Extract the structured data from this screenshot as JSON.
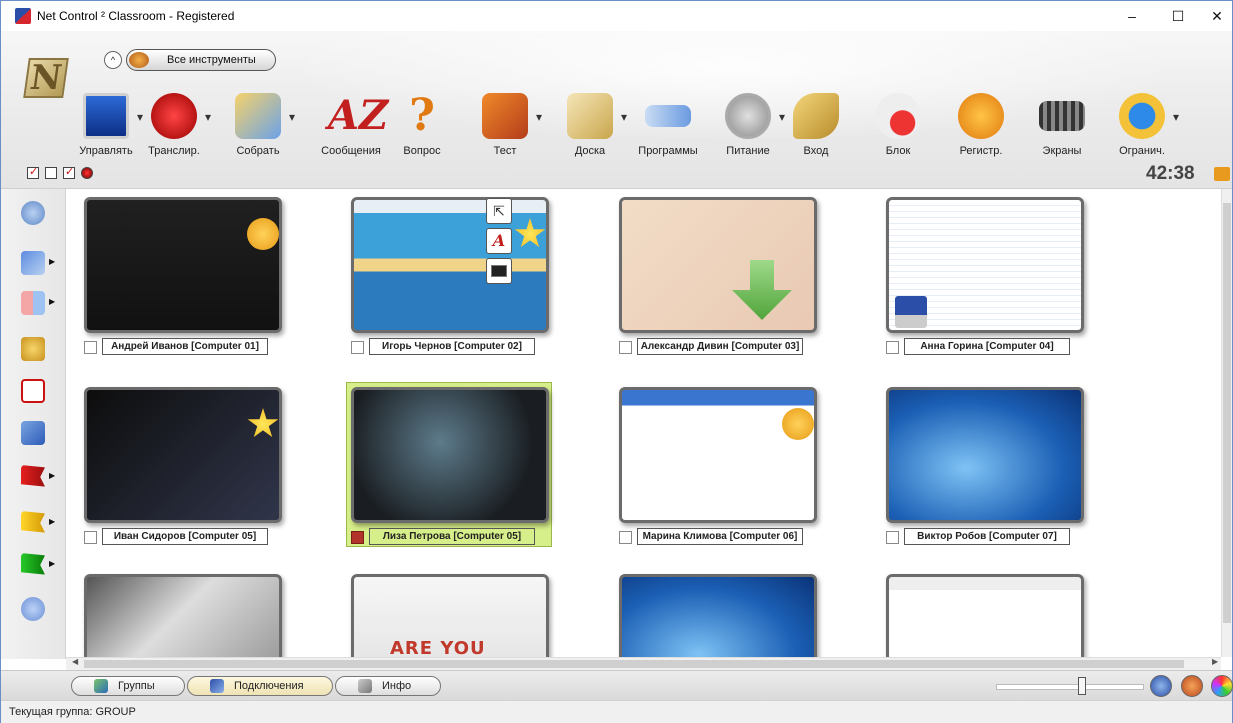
{
  "window": {
    "title": "Net Control ² Classroom - Registered",
    "controls": {
      "minimize": "–",
      "maximize": "☐",
      "close": "✕"
    }
  },
  "ribbon": {
    "logo_letter": "N",
    "collapse_glyph": "^",
    "all_tools_label": "Все инструменты",
    "tools": [
      {
        "id": "manage",
        "label": "Управлять",
        "icon": "monitor-icon",
        "has_dropdown": true
      },
      {
        "id": "broadcast",
        "label": "Транслир.",
        "icon": "broadcast-icon",
        "has_dropdown": true
      },
      {
        "id": "collect",
        "label": "Собрать",
        "icon": "collect-files-icon",
        "has_dropdown": true
      },
      {
        "id": "messages",
        "label": "Сообщения",
        "icon": "az-messages-icon",
        "has_dropdown": false
      },
      {
        "id": "question",
        "label": "Вопрос",
        "icon": "question-icon",
        "has_dropdown": false
      },
      {
        "id": "test",
        "label": "Тест",
        "icon": "test-icon",
        "has_dropdown": true
      },
      {
        "id": "board",
        "label": "Доска",
        "icon": "whiteboard-icon",
        "has_dropdown": true
      },
      {
        "id": "programs",
        "label": "Программы",
        "icon": "programs-icon",
        "has_dropdown": false
      },
      {
        "id": "power",
        "label": "Питание",
        "icon": "power-icon",
        "has_dropdown": true
      },
      {
        "id": "login",
        "label": "Вход",
        "icon": "keys-icon",
        "has_dropdown": false
      },
      {
        "id": "block",
        "label": "Блок",
        "icon": "block-mouse-icon",
        "has_dropdown": false
      },
      {
        "id": "register",
        "label": "Регистр.",
        "icon": "register-icon",
        "has_dropdown": false
      },
      {
        "id": "screens",
        "label": "Экраны",
        "icon": "filmstrip-icon",
        "has_dropdown": false
      },
      {
        "id": "restrict",
        "label": "Огранич.",
        "icon": "internet-restrict-icon",
        "has_dropdown": true
      }
    ],
    "dropdown_glyph": "▾",
    "timer": "42:38"
  },
  "left_rail": {
    "arrow_glyph": "▶",
    "items": [
      {
        "name": "refresh-icon",
        "has_arrow": false
      },
      {
        "name": "remote-view-icon",
        "has_arrow": true
      },
      {
        "name": "layout-grid-icon",
        "has_arrow": true
      },
      {
        "name": "lock-users-icon",
        "has_arrow": false
      },
      {
        "name": "text-to-student-icon",
        "has_arrow": false
      },
      {
        "name": "tools-icon",
        "has_arrow": false
      },
      {
        "name": "red-flag-icon",
        "has_arrow": true
      },
      {
        "name": "yellow-flag-icon",
        "has_arrow": true
      },
      {
        "name": "green-flag-icon",
        "has_arrow": true
      },
      {
        "name": "users-group-icon",
        "has_arrow": false
      }
    ]
  },
  "students": [
    {
      "name": "Андрей Иванов [Computer 01]",
      "screen": "sc-black",
      "overlay": "ov-hand",
      "selected": false
    },
    {
      "name": "Игорь Чернов [Computer 02]",
      "screen": "sc-beach",
      "overlay": "ov-star",
      "selected": false
    },
    {
      "name": "Александр Дивин [Computer 03]",
      "screen": "sc-beige",
      "overlay": "ov-arrow",
      "selected": false
    },
    {
      "name": "Анна Горина [Computer 04]",
      "screen": "sc-filemgr",
      "overlay": "ov-disk",
      "selected": false
    },
    {
      "name": "Иван Сидоров [Computer 05]",
      "screen": "sc-dark-edu",
      "overlay": "ov-star",
      "selected": false
    },
    {
      "name": "Лиза Петрова [Computer 05]",
      "screen": "sc-lock-screen",
      "overlay": "",
      "selected": true
    },
    {
      "name": "Марина Климова [Computer 06]",
      "screen": "sc-paint",
      "overlay": "ov-hand",
      "selected": false
    },
    {
      "name": "Виктор Робов [Computer 07]",
      "screen": "sc-win7",
      "overlay": "",
      "selected": false
    },
    {
      "name": "",
      "screen": "sc-locked",
      "overlay": "",
      "selected": false
    },
    {
      "name": "",
      "screen": "sc-ready",
      "overlay": "",
      "selected": false,
      "text": "ARE YOU READY?"
    },
    {
      "name": "",
      "screen": "sc-win7",
      "overlay": "",
      "selected": false
    },
    {
      "name": "",
      "screen": "sc-browser",
      "overlay": "",
      "selected": false
    }
  ],
  "bottom_tabs": [
    {
      "label": "Группы",
      "active": false
    },
    {
      "label": "Подключения",
      "active": true
    },
    {
      "label": "Инфо",
      "active": false
    }
  ],
  "status": {
    "text": "Текущая группа: GROUP"
  },
  "colors": {
    "accent_selected": "#d7ef8a",
    "timer": "#444444"
  }
}
